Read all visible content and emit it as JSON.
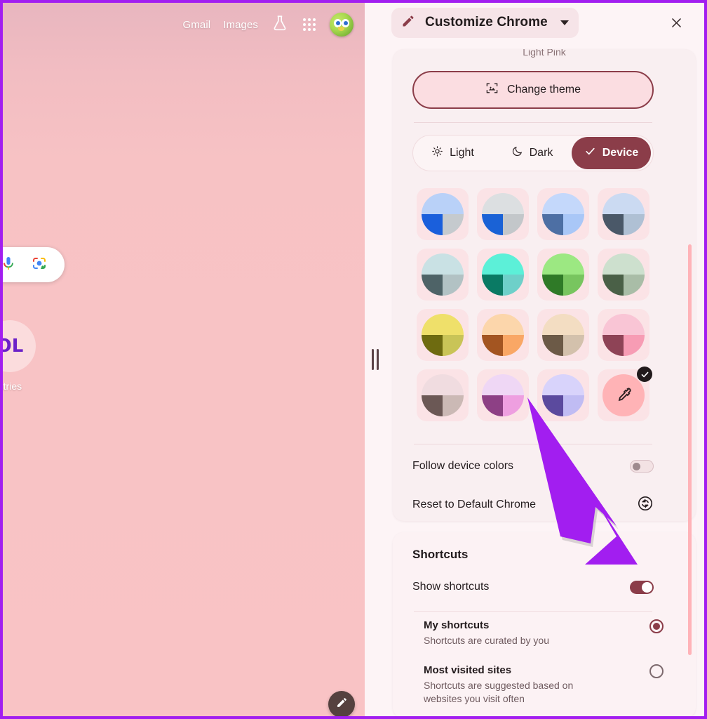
{
  "window": {
    "accent_border": "#a21ef0"
  },
  "ntp": {
    "links": [
      {
        "label": "Gmail",
        "name": "gmail-link"
      },
      {
        "label": "Images",
        "name": "images-link"
      }
    ],
    "icons": {
      "labs": "labs-flask-icon",
      "apps": "google-apps-icon",
      "avatar": "profile-avatar"
    },
    "search": {
      "mic": "microphone-icon",
      "lens": "google-lens-icon"
    },
    "shortcut": {
      "logo_text": "OL",
      "label": "ntries"
    },
    "fab": {
      "name": "edit-background-button",
      "icon": "pencil-icon"
    },
    "splitter": {
      "name": "panel-resize-handle"
    }
  },
  "panel": {
    "header": {
      "title": "Customize Chrome",
      "pencil_icon": "pencil-icon",
      "caret_icon": "chevron-down-icon",
      "close_icon": "close-icon"
    },
    "theme": {
      "current_theme_name": "Light Pink",
      "change_theme_label": "Change theme",
      "change_theme_icon": "image-icon",
      "modes": [
        {
          "label": "Light",
          "icon": "sun-icon",
          "selected": false
        },
        {
          "label": "Dark",
          "icon": "moon-icon",
          "selected": false
        },
        {
          "label": "Device",
          "icon": "check-icon",
          "selected": true
        }
      ],
      "swatches": [
        {
          "name": "swatch-blue-grey",
          "top": "#b9d1f8",
          "bl": "#1a5fdc",
          "br": "#c5cace"
        },
        {
          "name": "swatch-grey-blue",
          "top": "#dcdfe1",
          "bl": "#1a62d6",
          "br": "#c3c7ca"
        },
        {
          "name": "swatch-blue-light",
          "top": "#c4d8fb",
          "bl": "#4d6fa4",
          "br": "#a9c7f7"
        },
        {
          "name": "swatch-slate-blue",
          "top": "#cbdaf2",
          "bl": "#4a5868",
          "br": "#afc0d4"
        },
        {
          "name": "swatch-aqua-grey",
          "top": "#c9e1e4",
          "bl": "#4e6367",
          "br": "#b2c2c4"
        },
        {
          "name": "swatch-teal",
          "top": "#5cf0d8",
          "bl": "#0a7a64",
          "br": "#6ed0c9"
        },
        {
          "name": "swatch-green",
          "top": "#9ce882",
          "bl": "#2f7a27",
          "br": "#78c55f"
        },
        {
          "name": "swatch-sage",
          "top": "#cde0ce",
          "bl": "#4a6047",
          "br": "#a9bda7"
        },
        {
          "name": "swatch-yellow",
          "top": "#efe06a",
          "bl": "#6e6b10",
          "br": "#c9c457"
        },
        {
          "name": "swatch-orange",
          "top": "#fcd6ab",
          "bl": "#a35521",
          "br": "#f9a765"
        },
        {
          "name": "swatch-brown",
          "top": "#f3ddc2",
          "bl": "#6c5a47",
          "br": "#d3c1ac"
        },
        {
          "name": "swatch-pink-red",
          "top": "#f9c5d5",
          "bl": "#8e4356",
          "br": "#f79cb4"
        },
        {
          "name": "swatch-mauve",
          "top": "#f0dce0",
          "bl": "#6b5855",
          "br": "#cbb9b5"
        },
        {
          "name": "swatch-violet",
          "top": "#efd7f5",
          "bl": "#8d4085",
          "br": "#ee9fe0"
        },
        {
          "name": "swatch-purple",
          "top": "#d8d3fb",
          "bl": "#5b4a9e",
          "br": "#c0bcf3"
        },
        {
          "name": "swatch-custom-color",
          "top": "#ffb3b6",
          "bl": "#ffb3b6",
          "br": "#ffb3b6",
          "icon": "eyedropper-icon",
          "selected": true
        }
      ],
      "follow_device_colors": {
        "label": "Follow device colors",
        "on": false
      },
      "reset_default": {
        "label": "Reset to Default Chrome",
        "icon": "reset-icon"
      }
    },
    "shortcuts": {
      "section_title": "Shortcuts",
      "show_shortcuts": {
        "label": "Show shortcuts",
        "on": true
      },
      "options": [
        {
          "title": "My shortcuts",
          "desc": "Shortcuts are curated by you",
          "selected": true
        },
        {
          "title": "Most visited sites",
          "desc": "Shortcuts are suggested based on websites you visit often",
          "selected": false
        }
      ]
    },
    "scrollbar": {
      "name": "panel-scrollbar"
    }
  },
  "annotation": {
    "arrow_color": "#a21ef0",
    "points_to": "show-shortcuts-toggle"
  }
}
